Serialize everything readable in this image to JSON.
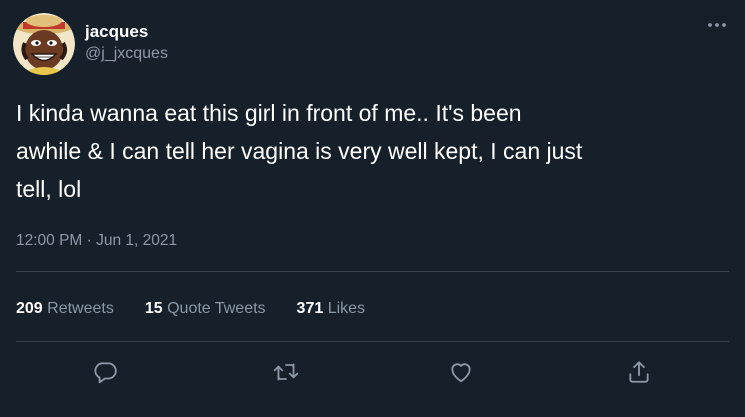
{
  "user": {
    "display_name": "jacques",
    "handle": "@j_jxcques"
  },
  "tweet": {
    "text": "I kinda wanna eat this girl in front of me.. It's been\nawhile & I can tell her vagina is very well kept, I can just\ntell, lol",
    "timestamp": "12:00 PM · Jun 1, 2021"
  },
  "stats": {
    "retweets_count": "209",
    "retweets_label": "Retweets",
    "quote_tweets_count": "15",
    "quote_tweets_label": "Quote Tweets",
    "likes_count": "371",
    "likes_label": "Likes"
  },
  "icons": {
    "more": "more-horizontal-icon",
    "reply": "reply-icon",
    "retweet": "retweet-icon",
    "like": "heart-icon",
    "share": "share-icon"
  },
  "colors": {
    "background": "#15202b",
    "text_primary": "#ffffff",
    "text_secondary": "#8b98a5",
    "divider": "#38444d"
  }
}
